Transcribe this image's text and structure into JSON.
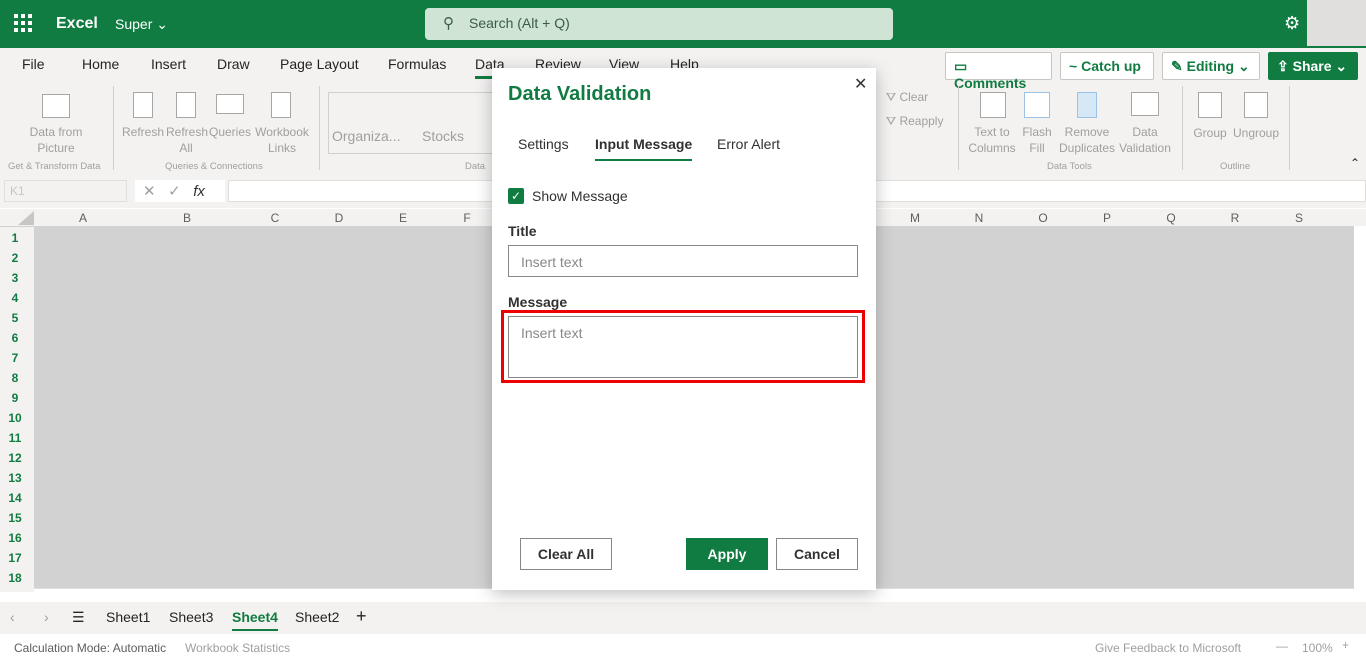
{
  "app": {
    "name": "Excel",
    "doc": "Super",
    "search_placeholder": "Search (Alt + Q)"
  },
  "tabs": [
    "File",
    "Home",
    "Insert",
    "Draw",
    "Page Layout",
    "Formulas",
    "Data",
    "Review",
    "View",
    "Help"
  ],
  "header_buttons": {
    "comments": "Comments",
    "catchup": "Catch up",
    "editing": "Editing",
    "share": "Share"
  },
  "ribbon": {
    "data_from_picture": "Data from Picture",
    "refresh": "Refresh",
    "refresh_all": "Refresh All",
    "queries": "Queries",
    "workbook_links": "Workbook Links",
    "organiza": "Organiza...",
    "stocks": "Stocks",
    "clear": "Clear",
    "reapply": "Reapply",
    "text_to_columns": "Text to Columns",
    "flash_fill": "Flash Fill",
    "remove_duplicates": "Remove Duplicates",
    "data_validation": "Data Validation",
    "group": "Group",
    "ungroup": "Ungroup",
    "groups": {
      "get_transform": "Get & Transform Data",
      "queries_conn": "Queries & Connections",
      "data_types": "Data",
      "data_tools": "Data Tools",
      "outline": "Outline"
    }
  },
  "formula_bar": {
    "name_box": "K1",
    "fx": "fx"
  },
  "columns": [
    "A",
    "B",
    "C",
    "D",
    "E",
    "F",
    "M",
    "N",
    "O",
    "P",
    "Q",
    "R",
    "S"
  ],
  "rows": [
    "1",
    "2",
    "3",
    "4",
    "5",
    "6",
    "7",
    "8",
    "9",
    "10",
    "11",
    "12",
    "13",
    "14",
    "15",
    "16",
    "17",
    "18"
  ],
  "sheets": [
    "Sheet1",
    "Sheet3",
    "Sheet4",
    "Sheet2"
  ],
  "active_sheet": "Sheet4",
  "status": {
    "calc": "Calculation Mode: Automatic",
    "stats": "Workbook Statistics",
    "feedback": "Give Feedback to Microsoft",
    "zoom": "100%"
  },
  "dialog": {
    "title": "Data Validation",
    "tabs": [
      "Settings",
      "Input Message",
      "Error Alert"
    ],
    "active_tab": "Input Message",
    "show_message_label": "Show Message",
    "show_message_checked": true,
    "title_label": "Title",
    "title_placeholder": "Insert text",
    "message_label": "Message",
    "message_placeholder": "Insert text",
    "clear_all": "Clear All",
    "apply": "Apply",
    "cancel": "Cancel"
  },
  "colors": {
    "brand": "#107c41",
    "highlight": "#ee0000"
  }
}
